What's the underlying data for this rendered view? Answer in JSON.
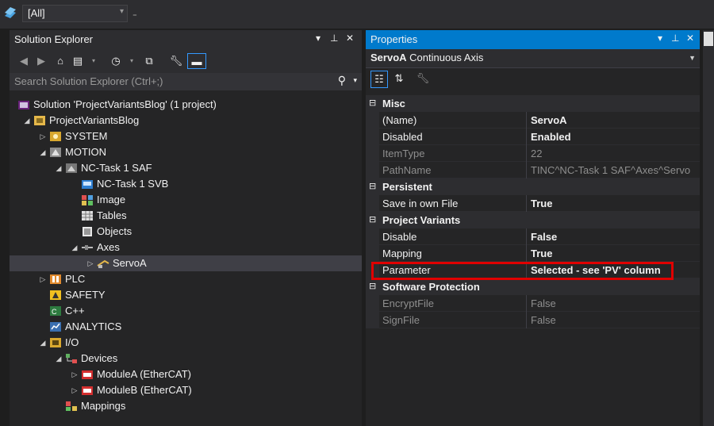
{
  "topbar": {
    "config_combo": "[All]"
  },
  "solution_explorer": {
    "title": "Solution Explorer",
    "search_placeholder": "Search Solution Explorer (Ctrl+;)",
    "tree": [
      {
        "label": "Solution 'ProjectVariantsBlog' (1 project)",
        "icon": "solution-icon",
        "level": 0,
        "expander": ""
      },
      {
        "label": "ProjectVariantsBlog",
        "icon": "project-icon",
        "level": 1,
        "expander": "open"
      },
      {
        "label": "SYSTEM",
        "icon": "system-icon",
        "level": 2,
        "expander": "closed"
      },
      {
        "label": "MOTION",
        "icon": "motion-icon",
        "level": 2,
        "expander": "open"
      },
      {
        "label": "NC-Task 1 SAF",
        "icon": "nc-task-icon",
        "level": 3,
        "expander": "open"
      },
      {
        "label": "NC-Task 1 SVB",
        "icon": "svb-icon",
        "level": 4,
        "expander": ""
      },
      {
        "label": "Image",
        "icon": "image-icon",
        "level": 4,
        "expander": ""
      },
      {
        "label": "Tables",
        "icon": "tables-icon",
        "level": 4,
        "expander": ""
      },
      {
        "label": "Objects",
        "icon": "objects-icon",
        "level": 4,
        "expander": ""
      },
      {
        "label": "Axes",
        "icon": "axes-icon",
        "level": 4,
        "expander": "open"
      },
      {
        "label": "ServoA",
        "icon": "axis-icon",
        "level": 5,
        "expander": "closed",
        "selected": true
      },
      {
        "label": "PLC",
        "icon": "plc-icon",
        "level": 2,
        "expander": "closed"
      },
      {
        "label": "SAFETY",
        "icon": "safety-icon",
        "level": 2,
        "expander": ""
      },
      {
        "label": "C++",
        "icon": "cpp-icon",
        "level": 2,
        "expander": ""
      },
      {
        "label": "ANALYTICS",
        "icon": "analytics-icon",
        "level": 2,
        "expander": ""
      },
      {
        "label": "I/O",
        "icon": "io-icon",
        "level": 2,
        "expander": "open"
      },
      {
        "label": "Devices",
        "icon": "devices-icon",
        "level": 3,
        "expander": "open"
      },
      {
        "label": "ModuleA (EtherCAT)",
        "icon": "ethercat-icon",
        "level": 4,
        "expander": "closed"
      },
      {
        "label": "ModuleB (EtherCAT)",
        "icon": "ethercat-icon",
        "level": 4,
        "expander": "closed"
      },
      {
        "label": "Mappings",
        "icon": "mappings-icon",
        "level": 3,
        "expander": ""
      }
    ]
  },
  "properties": {
    "title": "Properties",
    "object_name": "ServoA",
    "object_type": "Continuous Axis",
    "categories": [
      {
        "name": "Misc",
        "rows": [
          {
            "name": "(Name)",
            "value": "ServoA",
            "bold": true,
            "dim": false
          },
          {
            "name": "Disabled",
            "value": "Enabled",
            "bold": true,
            "dim": false
          },
          {
            "name": "ItemType",
            "value": "22",
            "bold": false,
            "dim": true
          },
          {
            "name": "PathName",
            "value": "TINC^NC-Task 1 SAF^Axes^Servo",
            "bold": false,
            "dim": true
          }
        ]
      },
      {
        "name": "Persistent",
        "rows": [
          {
            "name": "Save in own File",
            "value": "True",
            "bold": true,
            "dim": false
          }
        ]
      },
      {
        "name": "Project Variants",
        "rows": [
          {
            "name": "Disable",
            "value": "False",
            "bold": true,
            "dim": false
          },
          {
            "name": "Mapping",
            "value": "True",
            "bold": true,
            "dim": false
          },
          {
            "name": "Parameter",
            "value": "Selected - see 'PV' column",
            "bold": true,
            "dim": false
          }
        ]
      },
      {
        "name": "Software Protection",
        "rows": [
          {
            "name": "EncryptFile",
            "value": "False",
            "bold": false,
            "dim": true
          },
          {
            "name": "SignFile",
            "value": "False",
            "bold": false,
            "dim": true
          }
        ]
      }
    ]
  },
  "colors": {
    "accent": "#007acc",
    "highlight_box": "#e00000",
    "background": "#1e1e1e"
  }
}
